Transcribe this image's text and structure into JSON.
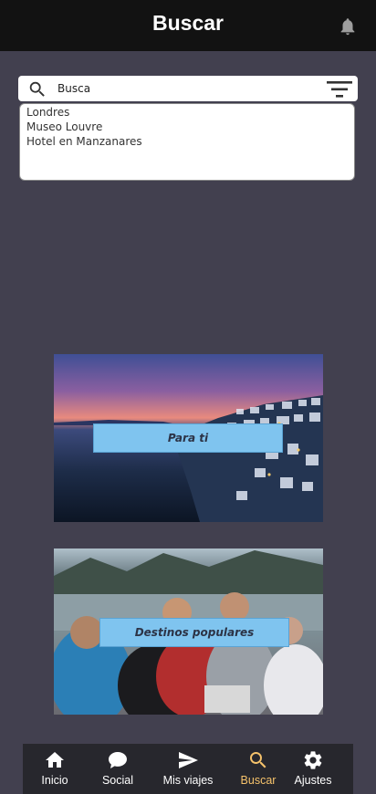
{
  "appbar": {
    "title": "Buscar",
    "notification_icon": "bell-icon"
  },
  "search": {
    "value": "Busca",
    "search_icon": "search-icon",
    "filter_icon": "filter-icon"
  },
  "suggestions": [
    "Londres",
    "Museo Louvre",
    "Hotel en Manzanares"
  ],
  "cards": [
    {
      "label": "Para ti"
    },
    {
      "label": "Destinos populares"
    }
  ],
  "nav": {
    "items": [
      {
        "label": "Inicio",
        "icon": "home-icon"
      },
      {
        "label": "Social",
        "icon": "chat-icon"
      },
      {
        "label": "Mis viajes",
        "icon": "send-icon"
      },
      {
        "label": "Buscar",
        "icon": "search-icon"
      },
      {
        "label": "Ajustes",
        "icon": "gear-icon"
      }
    ],
    "active": "Buscar",
    "active_color": "#f5c26b"
  },
  "colors": {
    "background": "#42404f",
    "appbar": "#121212",
    "card_label": "#7fc4ef"
  }
}
